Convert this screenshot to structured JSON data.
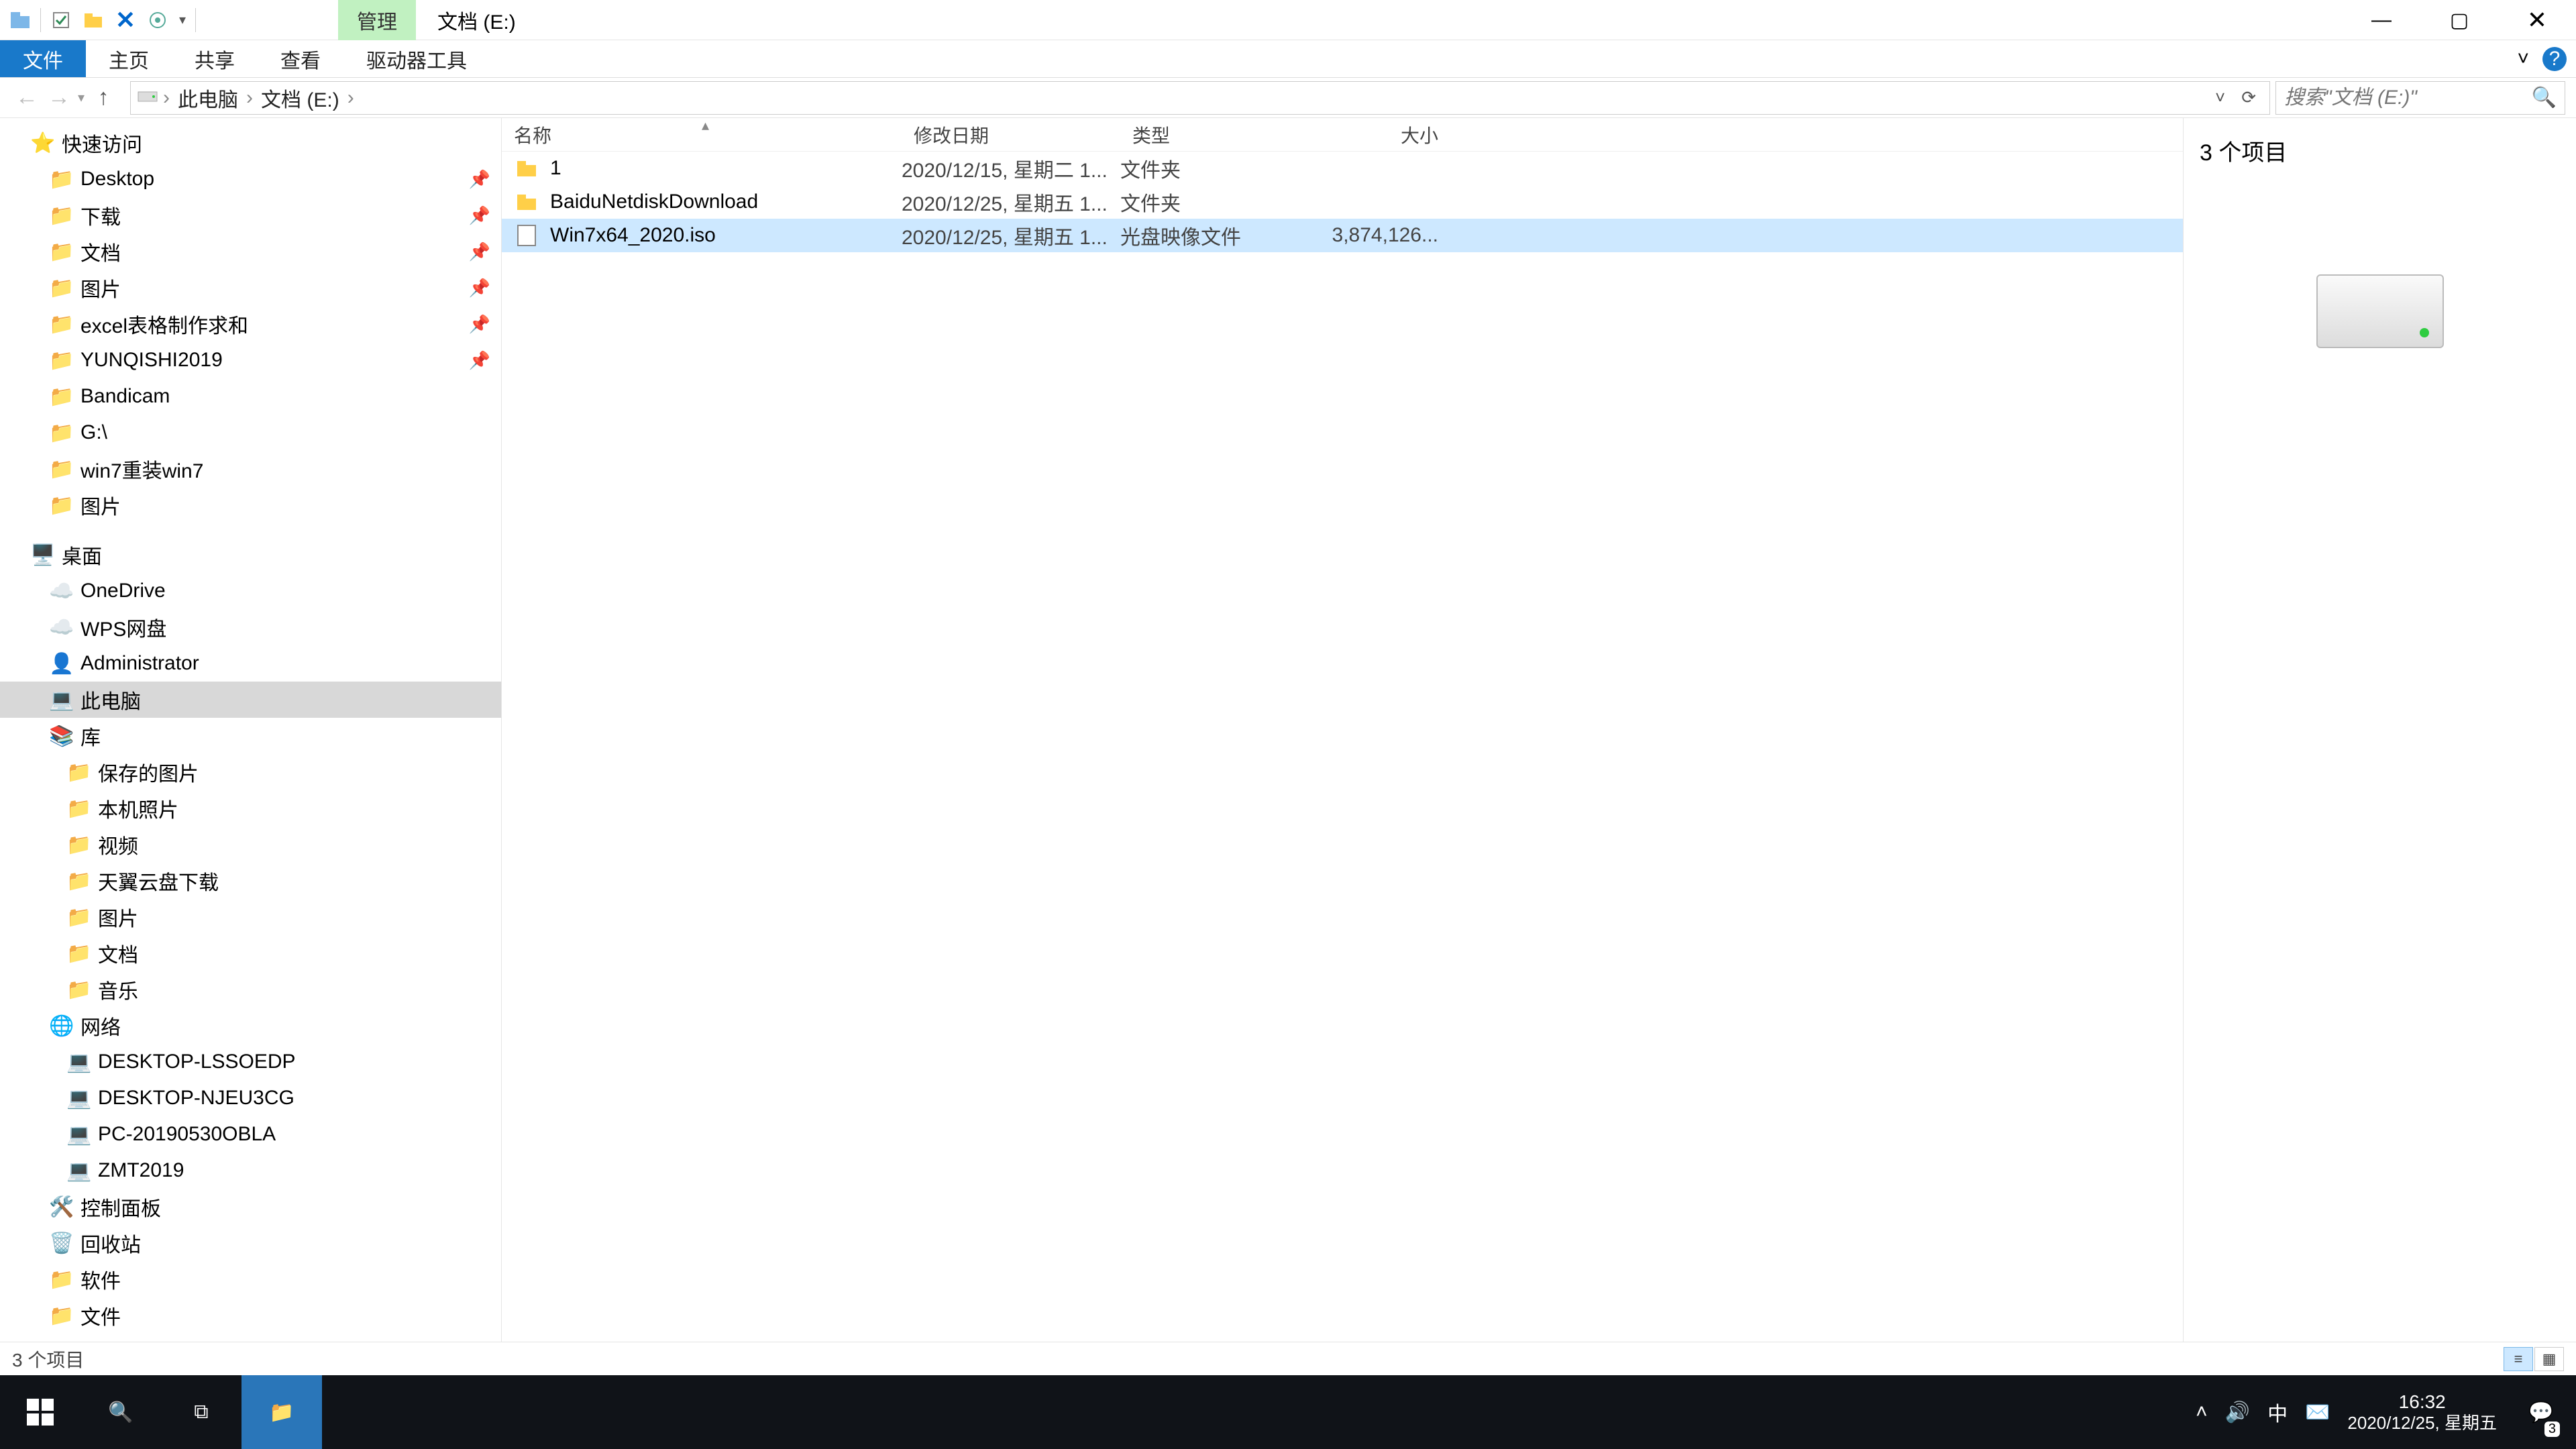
{
  "title": {
    "context_tab": "管理",
    "window": "文档 (E:)"
  },
  "window_controls": {
    "min": "—",
    "max": "▢",
    "close": "✕"
  },
  "ribbon": {
    "tabs": [
      "文件",
      "主页",
      "共享",
      "查看",
      "驱动器工具"
    ],
    "active_index": 0,
    "expand": "˅",
    "help": "?"
  },
  "nav": {
    "back": "←",
    "forward": "→",
    "up": "↑",
    "refresh": "⟳",
    "dropdown": "˅"
  },
  "breadcrumb": {
    "items": [
      "此电脑",
      "文档 (E:)"
    ],
    "sep": "›"
  },
  "search": {
    "placeholder": "搜索\"文档 (E:)\"",
    "icon": "🔍"
  },
  "tree": {
    "quick_access": "快速访问",
    "qa_items": [
      {
        "label": "Desktop",
        "pinned": true,
        "icon": "desktop"
      },
      {
        "label": "下载",
        "pinned": true,
        "icon": "download"
      },
      {
        "label": "文档",
        "pinned": true,
        "icon": "doc"
      },
      {
        "label": "图片",
        "pinned": true,
        "icon": "pic"
      },
      {
        "label": "excel表格制作求和",
        "pinned": true,
        "icon": "folder"
      },
      {
        "label": "YUNQISHI2019",
        "pinned": true,
        "icon": "folder-blue"
      },
      {
        "label": "Bandicam",
        "pinned": false,
        "icon": "folder"
      },
      {
        "label": "G:\\",
        "pinned": false,
        "icon": "drive"
      },
      {
        "label": "win7重装win7",
        "pinned": false,
        "icon": "folder"
      },
      {
        "label": "图片",
        "pinned": false,
        "icon": "pic"
      }
    ],
    "desktop": "桌面",
    "desktop_items": [
      {
        "label": "OneDrive",
        "icon": "cloud"
      },
      {
        "label": "WPS网盘",
        "icon": "cloud-blue"
      },
      {
        "label": "Administrator",
        "icon": "user"
      },
      {
        "label": "此电脑",
        "icon": "pc",
        "selected": true
      },
      {
        "label": "库",
        "icon": "library"
      }
    ],
    "library_items": [
      {
        "label": "保存的图片",
        "icon": "pic"
      },
      {
        "label": "本机照片",
        "icon": "pic"
      },
      {
        "label": "视频",
        "icon": "video"
      },
      {
        "label": "天翼云盘下载",
        "icon": "cloud"
      },
      {
        "label": "图片",
        "icon": "pic"
      },
      {
        "label": "文档",
        "icon": "doc"
      },
      {
        "label": "音乐",
        "icon": "music"
      }
    ],
    "network": "网络",
    "network_items": [
      {
        "label": "DESKTOP-LSSOEDP"
      },
      {
        "label": "DESKTOP-NJEU3CG"
      },
      {
        "label": "PC-20190530OBLA"
      },
      {
        "label": "ZMT2019"
      }
    ],
    "ctrl_panel": "控制面板",
    "recycle": "回收站",
    "software": "软件",
    "files": "文件"
  },
  "columns": {
    "name": "名称",
    "date": "修改日期",
    "type": "类型",
    "size": "大小"
  },
  "rows": [
    {
      "name": "1",
      "date": "2020/12/15, 星期二 1...",
      "type": "文件夹",
      "size": "",
      "kind": "folder"
    },
    {
      "name": "BaiduNetdiskDownload",
      "date": "2020/12/25, 星期五 1...",
      "type": "文件夹",
      "size": "",
      "kind": "folder"
    },
    {
      "name": "Win7x64_2020.iso",
      "date": "2020/12/25, 星期五 1...",
      "type": "光盘映像文件",
      "size": "3,874,126...",
      "kind": "iso",
      "selected": true
    }
  ],
  "preview": {
    "count_label": "3 个项目"
  },
  "status": {
    "text": "3 个项目"
  },
  "taskbar": {
    "time": "16:32",
    "date": "2020/12/25, 星期五",
    "ime": "中",
    "notif_count": "3"
  }
}
